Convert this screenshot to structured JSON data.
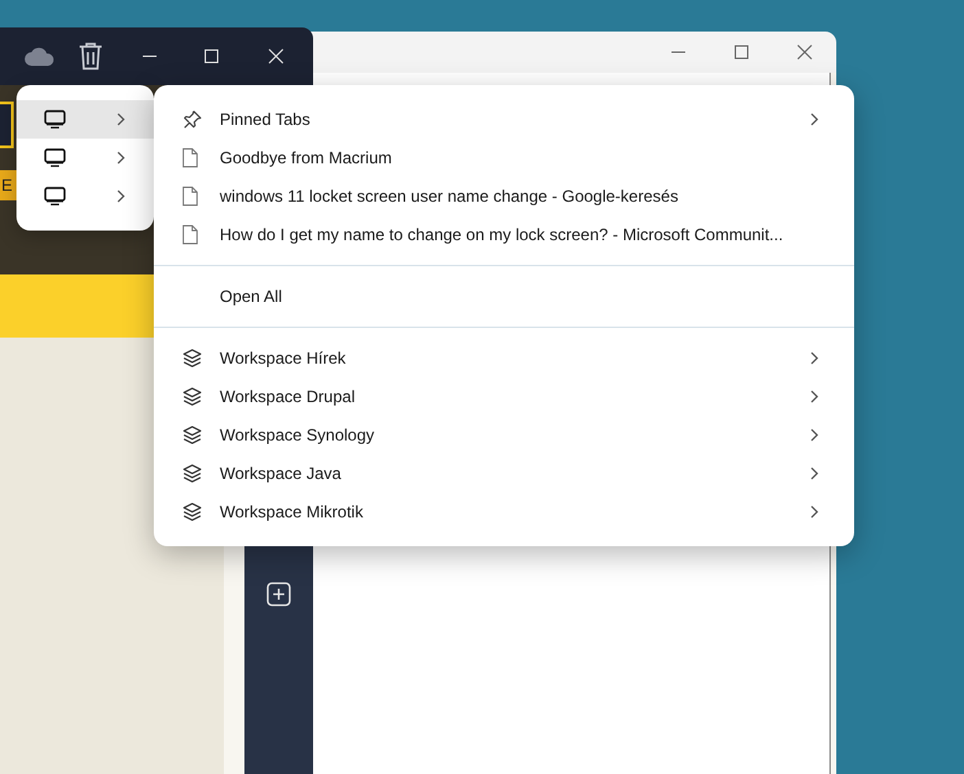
{
  "front_window": {
    "cut_text": "E"
  },
  "device_menu": {
    "items": [
      {
        "selected": true,
        "submenu": true
      },
      {
        "selected": false,
        "submenu": true
      },
      {
        "selected": false,
        "submenu": true
      }
    ]
  },
  "context_menu": {
    "sections": [
      {
        "items": [
          {
            "kind": "pinned",
            "label": "Pinned Tabs",
            "submenu": true
          },
          {
            "kind": "page",
            "label": "Goodbye from Macrium",
            "submenu": false
          },
          {
            "kind": "page",
            "label": "windows 11 locket screen user name change - Google-keresés",
            "submenu": false
          },
          {
            "kind": "page",
            "label": "How do I get my name to change on my lock screen? - Microsoft Communit...",
            "submenu": false
          }
        ]
      },
      {
        "items": [
          {
            "kind": "action",
            "label": "Open All",
            "submenu": false
          }
        ]
      },
      {
        "items": [
          {
            "kind": "workspace",
            "label": "Workspace Hírek",
            "submenu": true
          },
          {
            "kind": "workspace",
            "label": "Workspace Drupal",
            "submenu": true
          },
          {
            "kind": "workspace",
            "label": "Workspace Synology",
            "submenu": true
          },
          {
            "kind": "workspace",
            "label": "Workspace Java",
            "submenu": true
          },
          {
            "kind": "workspace",
            "label": "Workspace Mikrotik",
            "submenu": true
          }
        ]
      }
    ]
  }
}
